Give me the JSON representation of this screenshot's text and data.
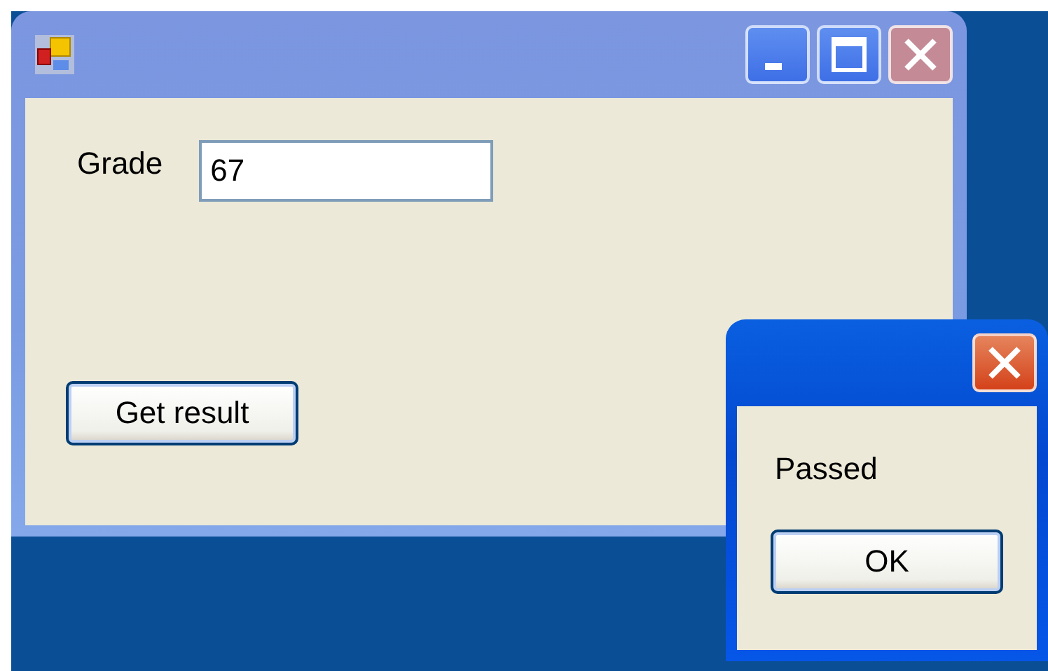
{
  "main_window": {
    "active": false,
    "grade_label": "Grade",
    "grade_value": "67",
    "button": "Get result"
  },
  "dialog": {
    "active": true,
    "message": "Passed",
    "button": "OK"
  }
}
